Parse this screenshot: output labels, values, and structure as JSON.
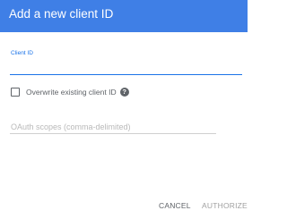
{
  "dialog": {
    "title": "Add a new client ID",
    "header_color": "#3f7fe6"
  },
  "client_id": {
    "label": "Client ID",
    "value": ""
  },
  "overwrite": {
    "label": "Overwrite existing client ID",
    "checked": false,
    "help_icon": "question-mark-circle-icon",
    "help_glyph": "?"
  },
  "scopes": {
    "placeholder": "OAuth scopes (comma-delimited)",
    "value": ""
  },
  "actions": {
    "cancel_label": "CANCEL",
    "authorize_label": "AUTHORIZE"
  }
}
